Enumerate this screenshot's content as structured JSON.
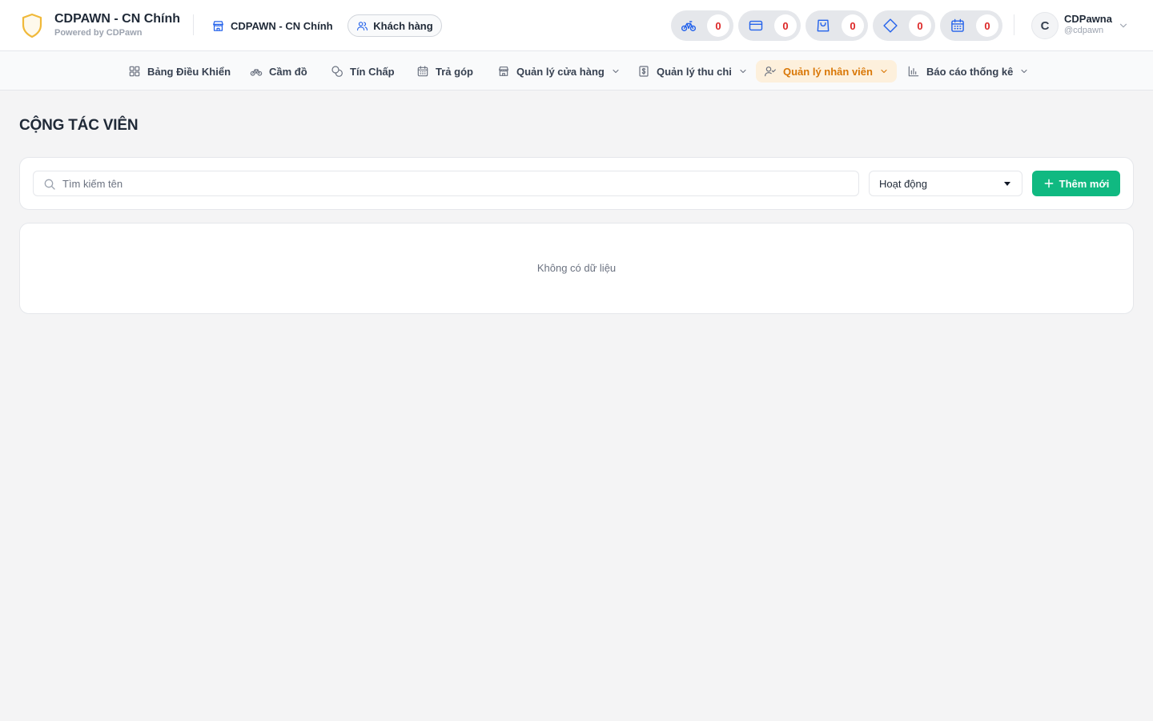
{
  "header": {
    "brand_title": "CDPAWN - CN Chính",
    "brand_subtitle": "Powered by CDPawn",
    "branch_name": "CDPAWN - CN Chính",
    "customer_button_label": "Khách hàng",
    "counters": [
      {
        "icon": "bicycle-icon",
        "value": "0"
      },
      {
        "icon": "credit-card-icon",
        "value": "0"
      },
      {
        "icon": "shopping-bag-icon",
        "value": "0"
      },
      {
        "icon": "diamond-icon",
        "value": "0"
      },
      {
        "icon": "calendar-icon",
        "value": "0"
      }
    ],
    "user": {
      "initial": "C",
      "name": "CDPawna",
      "handle": "@cdpawn"
    }
  },
  "nav": {
    "items": [
      {
        "label": "Bảng Điều Khiển",
        "icon": "dashboard-icon"
      },
      {
        "label": "Cầm đồ",
        "icon": "bicycle-icon"
      },
      {
        "label": "Tín Chấp",
        "icon": "coins-icon"
      },
      {
        "label": "Trả góp",
        "icon": "calendar-icon"
      },
      {
        "label": "Quản lý cửa hàng",
        "icon": "store-icon"
      },
      {
        "label": "Quản lý thu chi",
        "icon": "dollar-doc-icon"
      },
      {
        "label": "Quản lý nhân viên",
        "icon": "user-check-icon"
      },
      {
        "label": "Báo cáo thống kê",
        "icon": "bar-chart-icon"
      }
    ],
    "active": "Quản lý nhân viên"
  },
  "page": {
    "title": "CỘNG TÁC VIÊN",
    "search_placeholder": "Tìm kiếm tên",
    "search_value": "",
    "status_selected": "Hoạt động",
    "add_button_label": "Thêm mới",
    "empty_message": "Không có dữ liệu"
  },
  "colors": {
    "accent_orange": "#d97706",
    "accent_green": "#10b981",
    "counter_red": "#dc2626",
    "icon_blue": "#2563eb"
  }
}
